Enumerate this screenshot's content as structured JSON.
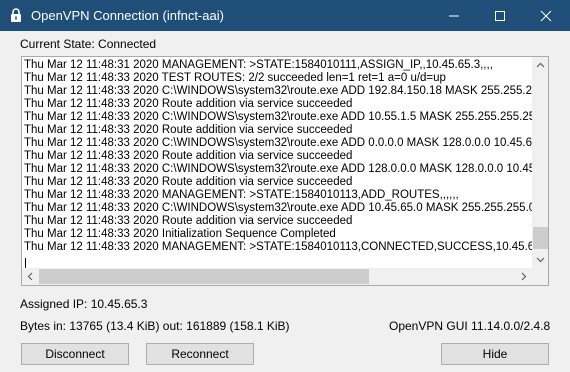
{
  "window": {
    "title": "OpenVPN Connection (infnct-aai)",
    "icon": "openvpn-lock-icon"
  },
  "status": {
    "current_state": "Current State: Connected",
    "assigned_ip": "Assigned IP: 10.45.65.3",
    "bytes_in_label": "Bytes in:",
    "bytes_in_value": "13765 (13.4 KiB)",
    "bytes_out_label": "out:",
    "bytes_out_value": "161889 (158.1 KiB)",
    "version": "OpenVPN GUI 11.14.0.0/2.4.8"
  },
  "log": {
    "lines": [
      "Thu Mar 12 11:48:31 2020 MANAGEMENT: >STATE:1584010111,ASSIGN_IP,,10.45.65.3,,,,",
      "Thu Mar 12 11:48:33 2020 TEST ROUTES: 2/2 succeeded len=1 ret=1 a=0 u/d=up",
      "Thu Mar 12 11:48:33 2020 C:\\WINDOWS\\system32\\route.exe ADD 192.84.150.18 MASK 255.255.255.255",
      "Thu Mar 12 11:48:33 2020 Route addition via service succeeded",
      "Thu Mar 12 11:48:33 2020 C:\\WINDOWS\\system32\\route.exe ADD 10.55.1.5 MASK 255.255.255.255 192",
      "Thu Mar 12 11:48:33 2020 Route addition via service succeeded",
      "Thu Mar 12 11:48:33 2020 C:\\WINDOWS\\system32\\route.exe ADD 0.0.0.0 MASK 128.0.0.0 10.45.65.1",
      "Thu Mar 12 11:48:33 2020 Route addition via service succeeded",
      "Thu Mar 12 11:48:33 2020 C:\\WINDOWS\\system32\\route.exe ADD 128.0.0.0 MASK 128.0.0.0 10.45.65.1",
      "Thu Mar 12 11:48:33 2020 Route addition via service succeeded",
      "Thu Mar 12 11:48:33 2020 MANAGEMENT: >STATE:1584010113,ADD_ROUTES,,,,,,",
      "Thu Mar 12 11:48:33 2020 C:\\WINDOWS\\system32\\route.exe ADD 10.45.65.0 MASK 255.255.255.0 10.4",
      "Thu Mar 12 11:48:33 2020 Route addition via service succeeded",
      "Thu Mar 12 11:48:33 2020 Initialization Sequence Completed",
      "Thu Mar 12 11:48:33 2020 MANAGEMENT: >STATE:1584010113,CONNECTED,SUCCESS,10.45.65.3,19"
    ]
  },
  "buttons": {
    "disconnect": "Disconnect",
    "reconnect": "Reconnect",
    "hide": "Hide"
  },
  "colors": {
    "titlebar": "#1f4e79",
    "window_bg": "#f0f0f0",
    "button_bg": "#e1e1e1"
  }
}
